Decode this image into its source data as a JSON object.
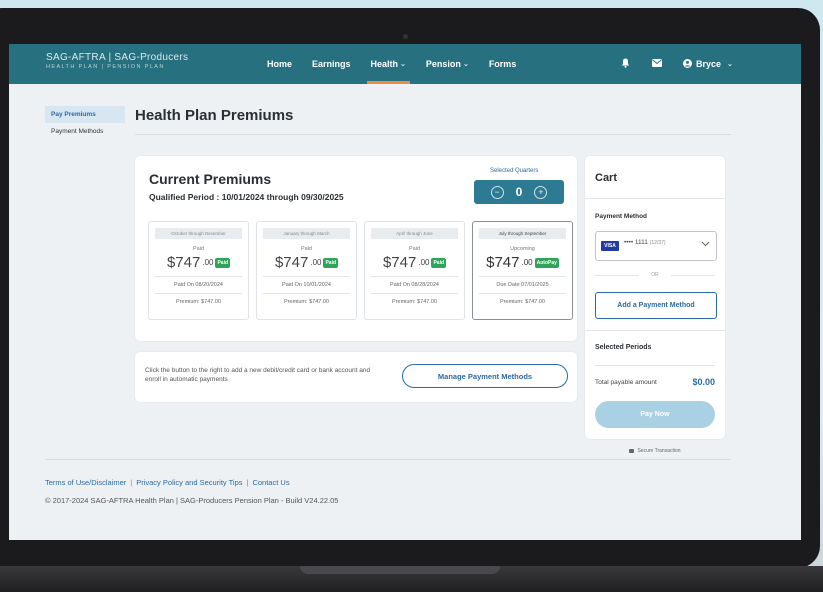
{
  "brand": {
    "line1": "SAG-AFTRA | SAG-Producers",
    "line2": "HEALTH PLAN | PENSION PLAN"
  },
  "nav": {
    "items": [
      {
        "label": "Home"
      },
      {
        "label": "Earnings"
      },
      {
        "label": "Health"
      },
      {
        "label": "Pension"
      },
      {
        "label": "Forms"
      }
    ],
    "user": "Bryce"
  },
  "sidebar": {
    "items": [
      {
        "label": "Pay Premiums"
      },
      {
        "label": "Payment Methods"
      }
    ]
  },
  "page": {
    "title": "Health Plan Premiums"
  },
  "premiums": {
    "title": "Current Premiums",
    "period": "Qualified Period : 10/01/2024 through 09/30/2025",
    "selected_quarters_label": "Selected Quarters",
    "selected_quarters_value": "0",
    "quarters": [
      {
        "range": "October through December",
        "status": "Paid",
        "amount": "$747",
        "cents": ".00",
        "badge": "Paid",
        "date": "Paid On 08/20/2024",
        "premium": "Premium: $747.00"
      },
      {
        "range": "January through March",
        "status": "Paid",
        "amount": "$747",
        "cents": ".00",
        "badge": "Paid",
        "date": "Paid On 10/01/2024",
        "premium": "Premium: $747.00"
      },
      {
        "range": "April through June",
        "status": "Paid",
        "amount": "$747",
        "cents": ".00",
        "badge": "Paid",
        "date": "Paid On 08/28/2024",
        "premium": "Premium: $747.00"
      },
      {
        "range": "July through September",
        "status": "Upcoming",
        "amount": "$747",
        "cents": ".00",
        "badge": "AutoPay",
        "date": "Due Date 07/01/2025",
        "premium": "Premium: $747.00"
      }
    ]
  },
  "manage": {
    "text": "Click the button to the right to add a new debit/credit card or bank account and enroll in automatic payments",
    "button": "Manage Payment Methods"
  },
  "cart": {
    "title": "Cart",
    "payment_method_label": "Payment Method",
    "card_brand": "VISA",
    "card_masked": "•••• 1111",
    "card_exp": "(12/37)",
    "or": "OR",
    "add_payment": "Add a Payment Method",
    "selected_periods": "Selected Periods",
    "total_label": "Total payable amount",
    "total_value": "$0.00",
    "pay_now": "Pay Now",
    "secure": "Secure Transaction"
  },
  "footer": {
    "links": [
      "Terms of Use/Disclaimer",
      "Privacy Policy and Security Tips",
      "Contact Us"
    ],
    "copyright": "© 2017-2024 SAG-AFTRA Health Plan | SAG-Producers Pension Plan - Build V24.22.05"
  },
  "colors": {
    "nav": "#27707f",
    "accent": "#2b6aa3",
    "active_tab": "#f08a3c",
    "paid_badge": "#2fa35a"
  }
}
